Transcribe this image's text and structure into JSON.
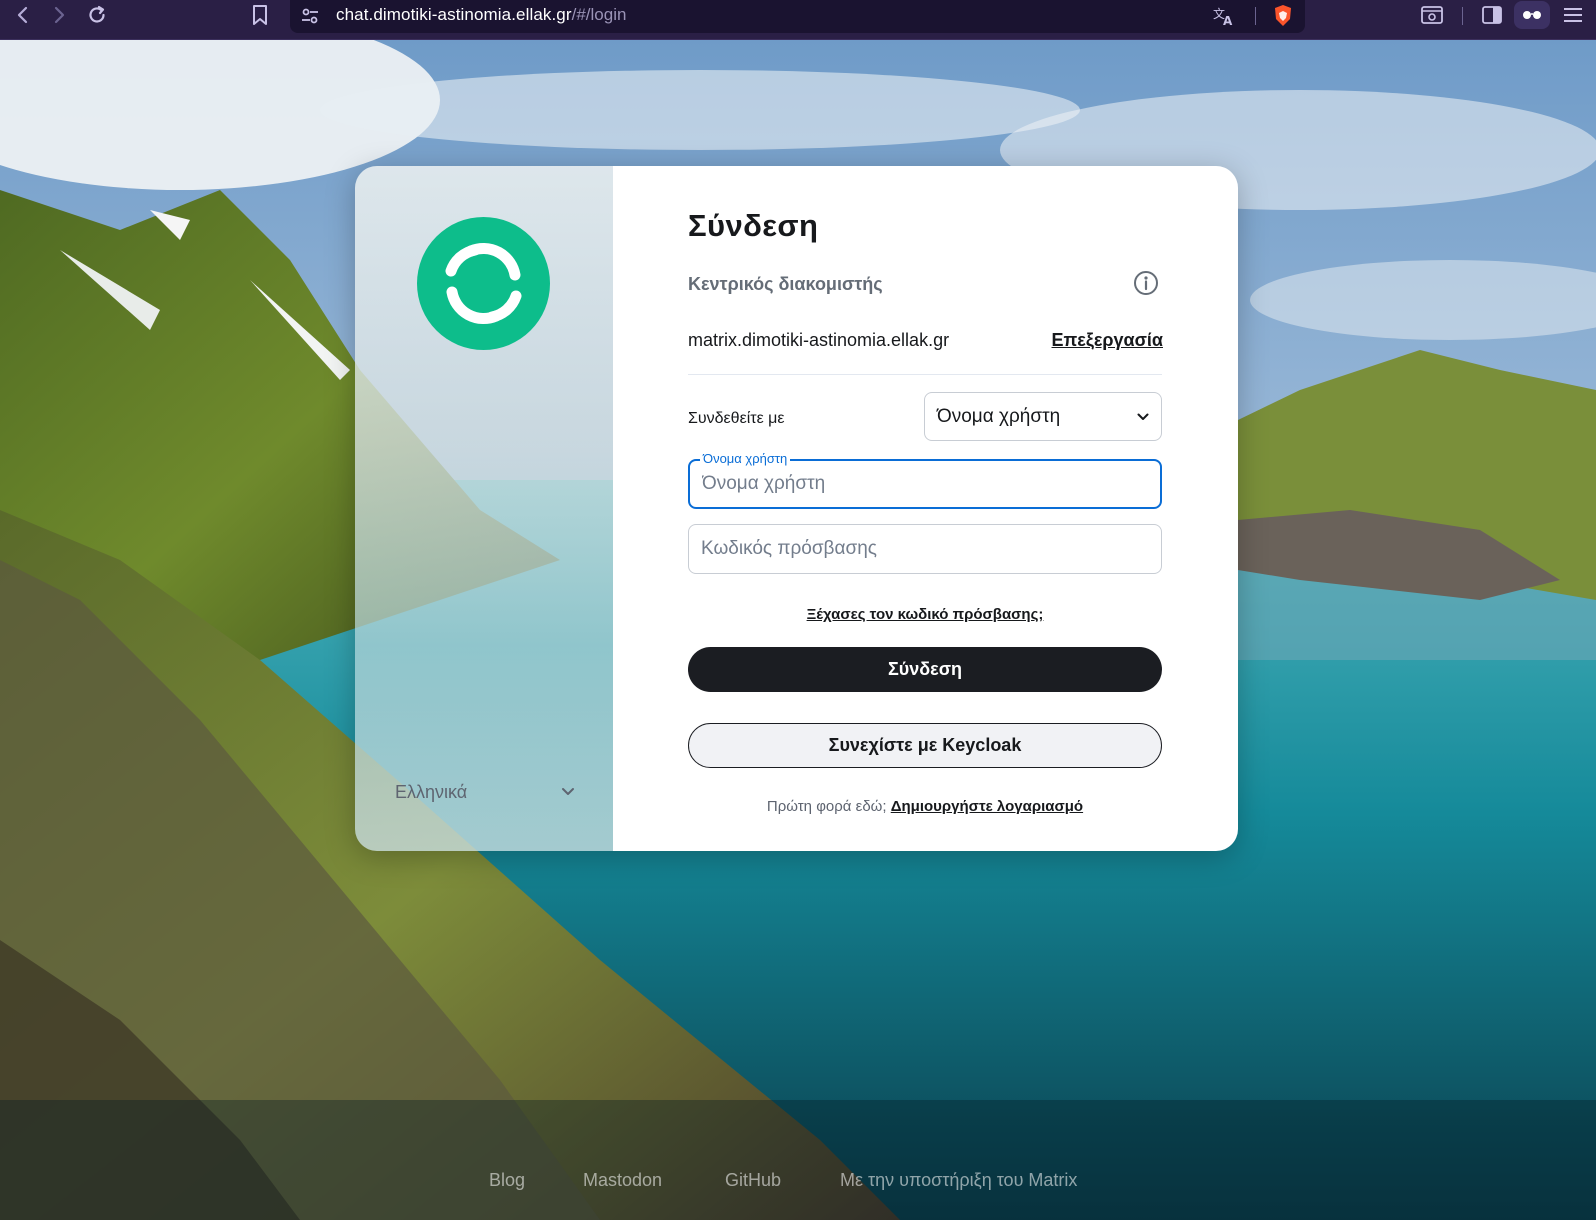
{
  "browser": {
    "url_host": "chat.dimotiki-astinomia.ellak.gr",
    "url_path": "/#/login"
  },
  "login": {
    "title": "Σύνδεση",
    "homeserver_label": "Κεντρικός διακομιστής",
    "homeserver_value": "matrix.dimotiki-astinomia.ellak.gr",
    "edit_label": "Επεξεργασία",
    "signin_with_label": "Συνδεθείτε με",
    "signin_with_selected": "Όνομα χρήστη",
    "username_float_label": "Όνομα χρήστη",
    "username_placeholder": "Όνομα χρήστη",
    "password_placeholder": "Κωδικός πρόσβασης",
    "forgot_password": "Ξέχασες τον κωδικό πρόσβασης;",
    "submit_label": "Σύνδεση",
    "sso_label": "Συνεχίστε με Keycloak",
    "register_prefix": "Πρώτη φορά εδώ;",
    "register_link": "Δημιουργήστε λογαριασμό"
  },
  "language": {
    "selected": "Ελληνικά"
  },
  "footer": {
    "links": [
      "Blog",
      "Mastodon",
      "GitHub",
      "Με την υποστήριξη του Matrix"
    ]
  },
  "colors": {
    "brand_green": "#0dbd8b",
    "focus_blue": "#0a6dd6",
    "chrome_bg": "#2a1f45"
  }
}
